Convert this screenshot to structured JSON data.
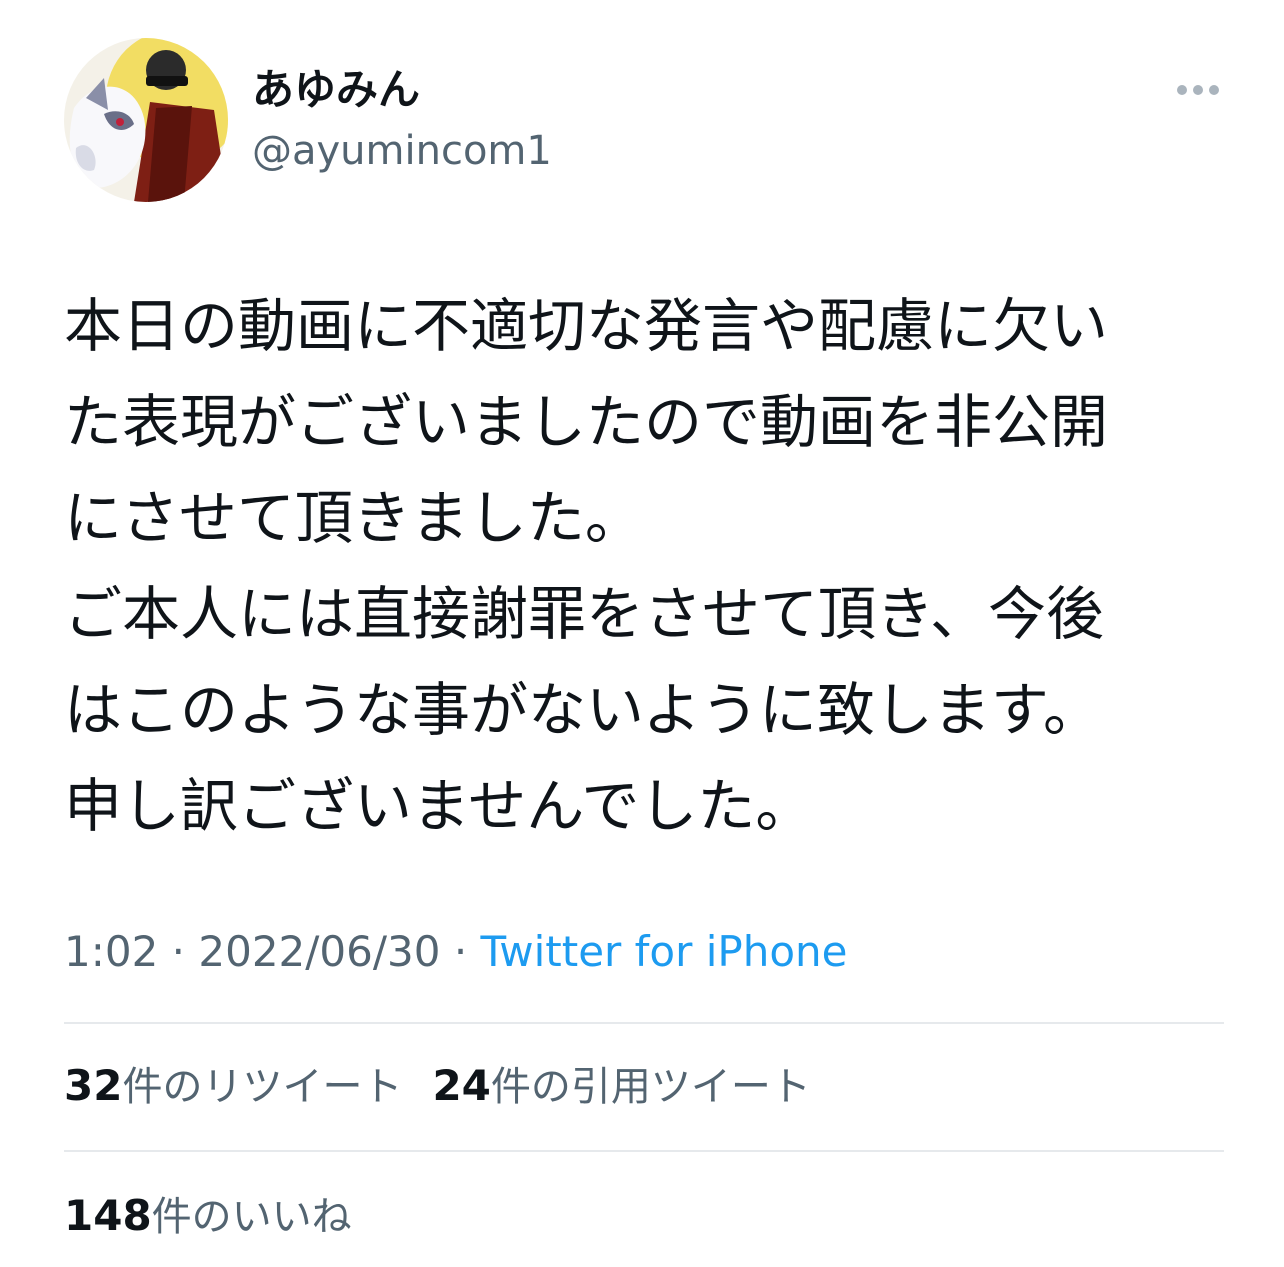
{
  "tweet": {
    "author": {
      "display_name": "あゆみん",
      "handle": "@ayumincom1",
      "avatar_icon": "profile-avatar"
    },
    "more_icon": "more-options-icon",
    "text": "本日の動画に不適切な発言や配慮に欠い\nた表現がございましたので動画を非公開\nにさせて頂きました。\nご本人には直接謝罪をさせて頂き、今後\nはこのような事がないように致します。\n申し訳ございませんでした。",
    "time": "1:02",
    "separator": " · ",
    "date": "2022/06/30",
    "source": "Twitter for iPhone"
  },
  "stats": {
    "retweets": {
      "count": "32",
      "label": "件のリツイート"
    },
    "quotes": {
      "count": "24",
      "label": "件の引用ツイート"
    },
    "likes": {
      "count": "148",
      "label": "件のいいね"
    }
  },
  "colors": {
    "text_primary": "#0f1419",
    "text_secondary": "#536471",
    "link": "#1d9bf0",
    "divider": "#e6e9ec"
  }
}
